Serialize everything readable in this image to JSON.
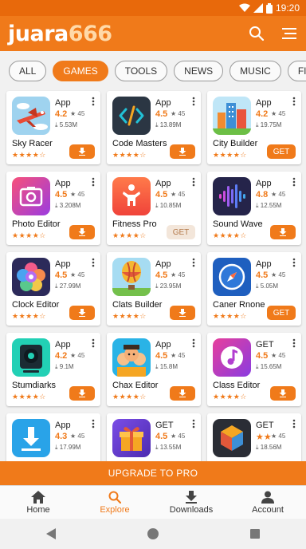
{
  "status_bar": {
    "time": "19:20"
  },
  "header": {
    "logo_text": "juara",
    "logo_number": "666",
    "search_icon": "search-icon",
    "menu_icon": "menu-icon"
  },
  "tabs": [
    {
      "label": "ALL",
      "active": false
    },
    {
      "label": "GAMES",
      "active": true
    },
    {
      "label": "TOOLS",
      "active": false
    },
    {
      "label": "NEWS",
      "active": false
    },
    {
      "label": "MUSIC",
      "active": false
    },
    {
      "label": "FITNESS",
      "active": false
    }
  ],
  "apps": [
    {
      "kind": "App",
      "rating": "4.2",
      "count": "45",
      "downloads": "5.53M",
      "name": "Sky Racer",
      "stars": "★★★★☆",
      "button": "download-icon"
    },
    {
      "kind": "App",
      "rating": "4.5",
      "count": "45",
      "downloads": "13.89M",
      "name": "Code Masters",
      "stars": "★★★★☆",
      "button": "download-icon"
    },
    {
      "kind": "App",
      "rating": "4.2",
      "count": "45",
      "downloads": "19.75M",
      "name": "City Builder",
      "stars": "★★★★☆",
      "button_text": "GET"
    },
    {
      "kind": "App",
      "rating": "4.5",
      "count": "45",
      "downloads": "3.208M",
      "name": "Photo Editor",
      "stars": "★★★★☆",
      "button": "download-icon"
    },
    {
      "kind": "App",
      "rating": "4.5",
      "count": "45",
      "downloads": "10.85M",
      "name": "Fitness Pro",
      "stars": "★★★★☆",
      "button_text": "GET",
      "button_style": "ghost"
    },
    {
      "kind": "App",
      "rating": "4.8",
      "count": "45",
      "downloads": "12.55M",
      "name": "Sound Wave",
      "stars": "★★★★☆",
      "button": "download-icon"
    },
    {
      "kind": "App",
      "rating": "4.5",
      "count": "45",
      "downloads": "27.99M",
      "name": "Clock Editor",
      "stars": "★★★★☆",
      "button": "download-icon"
    },
    {
      "kind": "App",
      "rating": "4.5",
      "count": "45",
      "downloads": "23.95M",
      "name": "Clats Builder",
      "stars": "★★★★☆",
      "button": "download-icon"
    },
    {
      "kind": "App",
      "rating": "4.5",
      "count": "45",
      "downloads": "5.05M",
      "name": "Caner Rnone",
      "stars": "★★★★☆",
      "button_text": "GET"
    },
    {
      "kind": "App",
      "rating": "4.2",
      "count": "45",
      "downloads": "9.1M",
      "name": "Stumdiarks",
      "stars": "★★★★☆",
      "button": "download-icon"
    },
    {
      "kind": "App",
      "rating": "4.5",
      "count": "45",
      "downloads": "15.8M",
      "name": "Chax Editor",
      "stars": "★★★★☆",
      "button": "download-icon"
    },
    {
      "kind": "GET",
      "rating": "4.5",
      "count": "45",
      "downloads": "15.65M",
      "name": "Class Editor",
      "stars": "★★★★☆",
      "button": "download-icon"
    },
    {
      "kind": "App",
      "rating": "4.3",
      "count": "45",
      "downloads": "17.99M",
      "name": "",
      "stars": "",
      "button": "download-icon"
    },
    {
      "kind": "GET",
      "rating": "4.5",
      "count": "45",
      "downloads": "13.55M",
      "name": "",
      "stars": "",
      "button": "download-icon"
    },
    {
      "kind": "GET",
      "rating": "★★",
      "count": "45",
      "downloads": "18.56M",
      "name": "",
      "stars": "",
      "button": "download-icon"
    }
  ],
  "upgrade": {
    "label": "UPGRADE TO PRO"
  },
  "bottom_nav": [
    {
      "label": "Home",
      "icon": "home-icon",
      "active": false
    },
    {
      "label": "Explore",
      "icon": "search-icon",
      "active": true
    },
    {
      "label": "Downloads",
      "icon": "download-icon",
      "active": false
    },
    {
      "label": "Account",
      "icon": "person-icon",
      "active": false
    }
  ],
  "colors": {
    "primary": "#f07a1a",
    "status_bar": "#e8690b",
    "background": "#f1f1f1"
  }
}
